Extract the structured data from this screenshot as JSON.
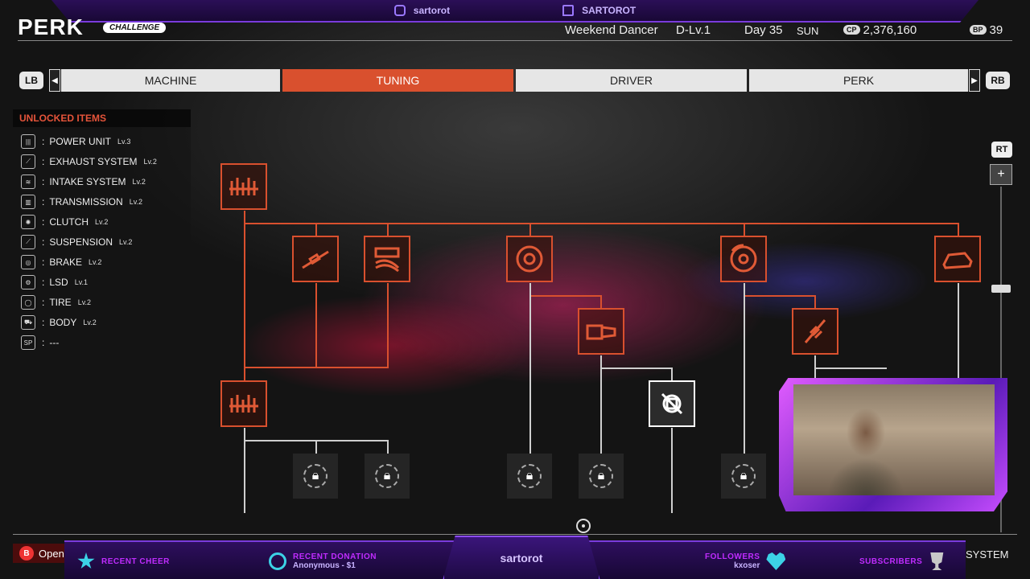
{
  "header": {
    "title": "PERK",
    "badge": "CHALLENGE",
    "driver_name": "Weekend Dancer",
    "driver_level": "D-Lv.1",
    "day": "Day 35",
    "weekday": "SUN",
    "cp_label": "CP",
    "cp_value": "2,376,160",
    "bp_label": "BP",
    "bp_value": "39"
  },
  "stream_top": {
    "instagram": "sartorot",
    "twitch": "SARTOROT"
  },
  "tabs": {
    "lb": "LB",
    "rb": "RB",
    "items": [
      {
        "label": "MACHINE"
      },
      {
        "label": "TUNING"
      },
      {
        "label": "DRIVER"
      },
      {
        "label": "PERK"
      }
    ],
    "active": "TUNING"
  },
  "unlocked": {
    "title": "UNLOCKED ITEMS",
    "items": [
      {
        "name": "POWER UNIT",
        "level": "Lv.3",
        "icon": "power-unit-icon"
      },
      {
        "name": "EXHAUST SYSTEM",
        "level": "Lv.2",
        "icon": "exhaust-icon"
      },
      {
        "name": "INTAKE SYSTEM",
        "level": "Lv.2",
        "icon": "intake-icon"
      },
      {
        "name": "TRANSMISSION",
        "level": "Lv.2",
        "icon": "transmission-icon"
      },
      {
        "name": "CLUTCH",
        "level": "Lv.2",
        "icon": "clutch-icon"
      },
      {
        "name": "SUSPENSION",
        "level": "Lv.2",
        "icon": "suspension-icon"
      },
      {
        "name": "BRAKE",
        "level": "Lv.2",
        "icon": "brake-icon"
      },
      {
        "name": "LSD",
        "level": "Lv.1",
        "icon": "lsd-icon"
      },
      {
        "name": "TIRE",
        "level": "Lv.2",
        "icon": "tire-icon"
      },
      {
        "name": "BODY",
        "level": "Lv.2",
        "icon": "body-icon"
      },
      {
        "name": "---",
        "level": "",
        "icon": "sp-icon",
        "badge": "SP"
      }
    ]
  },
  "zoom": {
    "rt": "RT",
    "plus": "+"
  },
  "footer": {
    "back_key": "B",
    "back_label": "Open",
    "system": "SYSTEM"
  },
  "stream_bottom": {
    "recent_cheer_label": "RECENT CHEER",
    "recent_donation_label": "RECENT DONATION",
    "recent_donation_value": "Anonymous - $1",
    "channel": "sartorot",
    "followers_label": "FOLLOWERS",
    "followers_value": "kxoser",
    "subscribers_label": "SUBSCRIBERS"
  },
  "colors": {
    "accent": "#d9502e",
    "stream_purple": "#7a3bdc",
    "stream_cyan": "#3cd2e6"
  }
}
